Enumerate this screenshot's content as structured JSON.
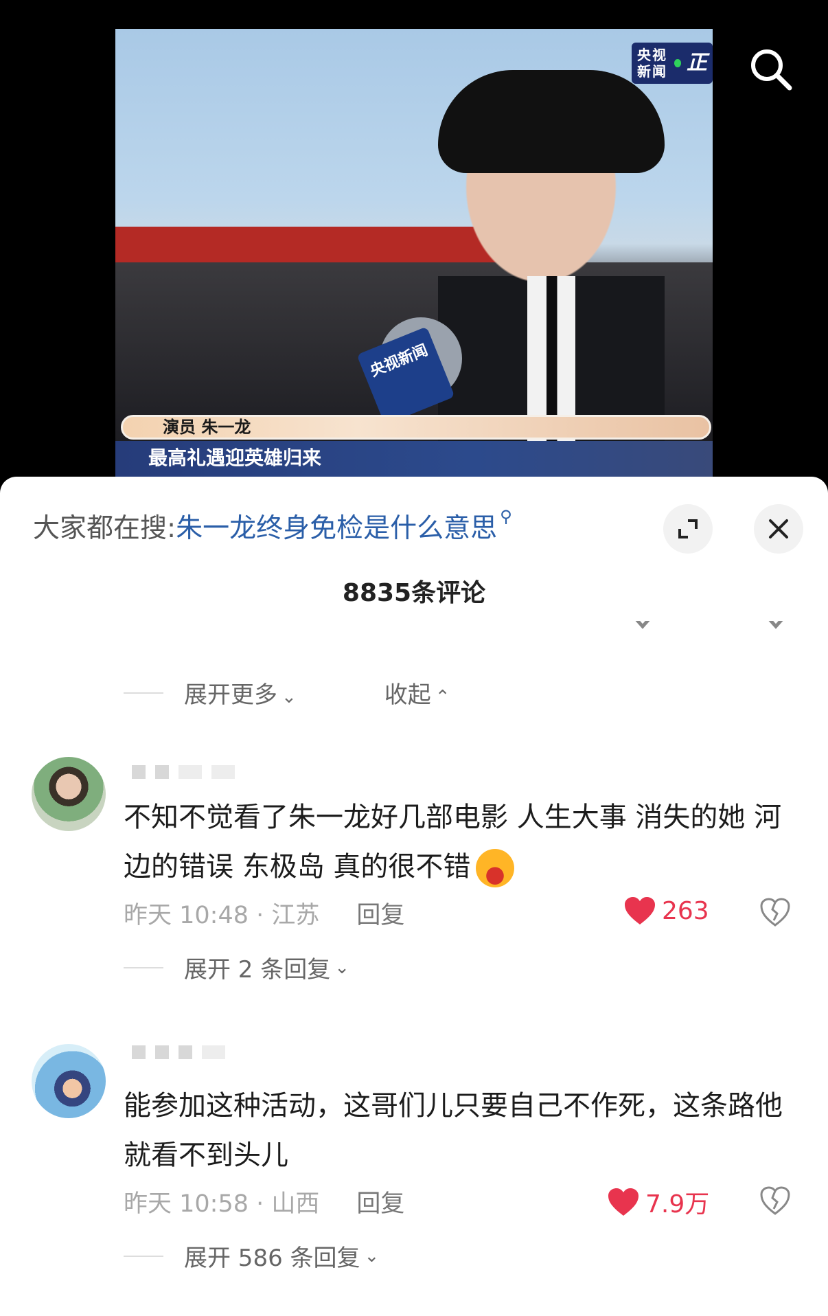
{
  "video": {
    "channel_logo": "央视新闻",
    "mic_flag_text": "央视新闻",
    "caption_name": "演员 朱一龙",
    "caption_headline": "最高礼遇迎英雄归来"
  },
  "icons": {
    "top_search": "search-icon",
    "expand": "expand-icon",
    "close": "close-icon",
    "like": "heart-icon",
    "dislike": "broken-heart-icon"
  },
  "search_bar": {
    "prefix": "大家都在搜:",
    "query": "朱一龙终身免检是什么意思",
    "icon_glyph": "⚲"
  },
  "comments_header": {
    "count_label": "8835条评论"
  },
  "thread_controls": {
    "expand_more": "展开更多",
    "collapse": "收起"
  },
  "comments": [
    {
      "text_part1": "不知不觉看了朱一龙好几部电影 人生大事 消失的她 河边的错误 东极岛 真的很不错",
      "time_location": "昨天 10:48 · 江苏",
      "reply_label": "回复",
      "likes": "263",
      "expand_replies": "展开 2 条回复"
    },
    {
      "text_part1": "能参加这种活动，这哥们儿只要自己不作死，这条路他就看不到头儿",
      "time_location": "昨天 10:58 · 山西",
      "reply_label": "回复",
      "likes": "7.9万",
      "expand_replies": "展开 586 条回复"
    }
  ],
  "colors": {
    "link_blue": "#2a5ea8",
    "like_red": "#e8344e",
    "muted_gray": "#a8a8a8"
  }
}
